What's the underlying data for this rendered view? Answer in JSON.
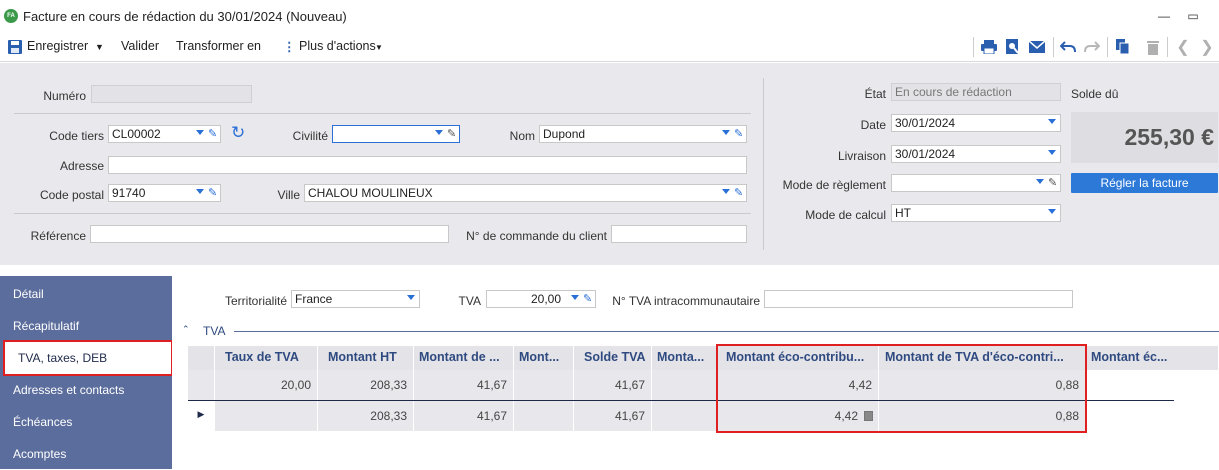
{
  "window": {
    "logo_text": "FA",
    "title": "Facture en cours de rédaction du 30/01/2024 (Nouveau)"
  },
  "toolbar": {
    "save_label": "Enregistrer",
    "validate_label": "Valider",
    "transform_label": "Transformer en",
    "more_label": "Plus d'actions"
  },
  "form": {
    "numero_label": "Numéro",
    "numero_value": "",
    "code_tiers_label": "Code tiers",
    "code_tiers_value": "CL00002",
    "civilite_label": "Civilité",
    "civilite_value": "",
    "nom_label": "Nom",
    "nom_value": "Dupond",
    "adresse_label": "Adresse",
    "adresse_value": "",
    "code_postal_label": "Code postal",
    "code_postal_value": "91740",
    "ville_label": "Ville",
    "ville_value": "CHALOU MOULINEUX",
    "reference_label": "Référence",
    "reference_value": "",
    "num_commande_label": "N° de commande du client",
    "num_commande_value": "",
    "etat_label": "État",
    "etat_value": "En cours de rédaction",
    "solde_label": "Solde dû",
    "solde_value": "255,30 €",
    "date_label": "Date",
    "date_value": "30/01/2024",
    "livraison_label": "Livraison",
    "livraison_value": "30/01/2024",
    "mode_reglement_label": "Mode de règlement",
    "mode_reglement_value": "",
    "mode_calcul_label": "Mode de calcul",
    "mode_calcul_value": "HT",
    "pay_button": "Régler la facture"
  },
  "sidebar": {
    "items": [
      {
        "label": "Détail"
      },
      {
        "label": "Récapitulatif"
      },
      {
        "label": "TVA, taxes, DEB"
      },
      {
        "label": "Adresses et contacts"
      },
      {
        "label": "Échéances"
      },
      {
        "label": "Acomptes"
      }
    ]
  },
  "tva_panel": {
    "territorialite_label": "Territorialité",
    "territorialite_value": "France",
    "tva_label": "TVA",
    "tva_value": "20,00",
    "num_tva_label": "N° TVA intracommunautaire",
    "num_tva_value": "",
    "section_title": "TVA",
    "columns": [
      "Taux de TVA",
      "Montant HT",
      "Montant de ...",
      "Mont...",
      "Solde TVA",
      "Monta...",
      "Montant éco-contribu...",
      "Montant de TVA d'éco-contri...",
      "Montant éc..."
    ],
    "rows": [
      [
        "20,00",
        "208,33",
        "41,67",
        "",
        "41,67",
        "",
        "4,42",
        "0,88"
      ],
      [
        "",
        "208,33",
        "41,67",
        "",
        "41,67",
        "",
        "4,42",
        "0,88"
      ]
    ]
  },
  "colors": {
    "accent": "#2d79d8",
    "sidebar": "#5b6d9c",
    "header_text": "#2f4a80",
    "highlight": "#e02020"
  }
}
